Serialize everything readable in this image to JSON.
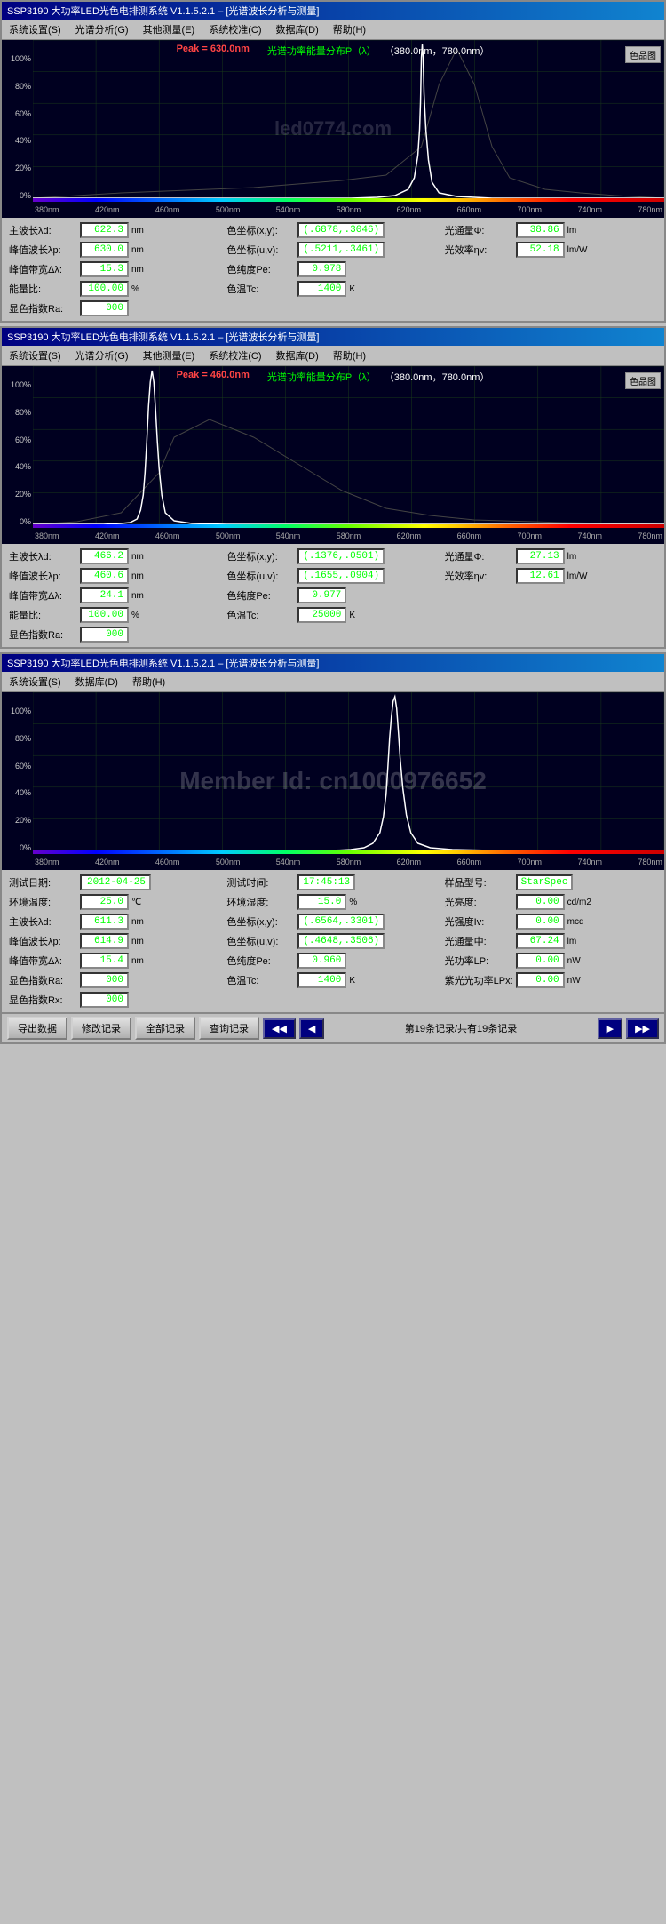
{
  "panels": [
    {
      "id": "panel1",
      "title": "SSP3190  大功率LED光色电排测系统 V1.1.5.2.1 – [光谱波长分析与测量]",
      "menu": [
        "系统设置(S)",
        "光谱分析(G)",
        "其他测量(E)",
        "系统校准(C)",
        "数据库(D)",
        "帮助(H)"
      ],
      "chart": {
        "peak_label": "Peak = 630.0nm",
        "range_label": "光谱功率能量分布P（λ）",
        "range_value": "（380.0nm，780.0nm）",
        "color_btn": "色品图",
        "watermark": "led0774.com",
        "y_axis": [
          "100%",
          "80%",
          "60%",
          "40%",
          "20%",
          "0%"
        ],
        "x_axis": [
          "380nm",
          "420nm",
          "460nm",
          "500nm",
          "540nm",
          "580nm",
          "620nm",
          "660nm",
          "700nm",
          "740nm",
          "780nm"
        ],
        "curve_peak_x": 0.615,
        "curve_type": "red_narrow"
      },
      "data": [
        {
          "label": "主波长λd:",
          "value": "622.3",
          "unit": "nm",
          "col": 1
        },
        {
          "label": "色坐标(x,y):",
          "value": "(.6878,.3046)",
          "unit": "",
          "col": 2
        },
        {
          "label": "光通量Φ:",
          "value": "38.86",
          "unit": "lm",
          "col": 3
        },
        {
          "label": "峰值波长λp:",
          "value": "630.0",
          "unit": "nm",
          "col": 1
        },
        {
          "label": "色坐标(u,v):",
          "value": "(.5211,.3461)",
          "unit": "",
          "col": 2
        },
        {
          "label": "光效率ηv:",
          "value": "52.18",
          "unit": "lm/W",
          "col": 3
        },
        {
          "label": "峰值带宽Δλ:",
          "value": "15.3",
          "unit": "nm",
          "col": 1
        },
        {
          "label": "色纯度Pe:",
          "value": "0.978",
          "unit": "",
          "col": 2
        },
        {
          "label": "",
          "value": "",
          "unit": "",
          "col": 3
        },
        {
          "label": "能量比:",
          "value": "100.00",
          "unit": "%",
          "col": 1
        },
        {
          "label": "色温Tc:",
          "value": "1400",
          "unit": "K",
          "col": 2
        },
        {
          "label": "",
          "value": "",
          "unit": "",
          "col": 3
        },
        {
          "label": "显色指数Ra:",
          "value": "000",
          "unit": "",
          "col": 1
        },
        {
          "label": "",
          "value": "",
          "unit": "",
          "col": 2
        },
        {
          "label": "",
          "value": "",
          "unit": "",
          "col": 3
        }
      ]
    },
    {
      "id": "panel2",
      "title": "SSP3190  大功率LED光色电排测系统 V1.1.5.2.1 – [光谱波长分析与测量]",
      "menu": [
        "系统设置(S)",
        "光谱分析(G)",
        "其他测量(E)",
        "系统校准(C)",
        "数据库(D)",
        "帮助(H)"
      ],
      "chart": {
        "peak_label": "Peak = 460.0nm",
        "range_label": "光谱功率能量分布P（λ）",
        "range_value": "（380.0nm，780.0nm）",
        "color_btn": "色品图",
        "watermark": "",
        "y_axis": [
          "100%",
          "80%",
          "60%",
          "40%",
          "20%",
          "0%"
        ],
        "x_axis": [
          "380nm",
          "420nm",
          "460nm",
          "500nm",
          "540nm",
          "580nm",
          "620nm",
          "660nm",
          "700nm",
          "740nm",
          "780nm"
        ],
        "curve_peak_x": 0.21,
        "curve_type": "blue_narrow"
      },
      "data": [
        {
          "label": "主波长λd:",
          "value": "466.2",
          "unit": "nm",
          "col": 1
        },
        {
          "label": "色坐标(x,y):",
          "value": "(.1376,.0501)",
          "unit": "",
          "col": 2
        },
        {
          "label": "光通量Φ:",
          "value": "27.13",
          "unit": "lm",
          "col": 3
        },
        {
          "label": "峰值波长λp:",
          "value": "460.6",
          "unit": "nm",
          "col": 1
        },
        {
          "label": "色坐标(u,v):",
          "value": "(.1655,.0904)",
          "unit": "",
          "col": 2
        },
        {
          "label": "光效率ηv:",
          "value": "12.61",
          "unit": "lm/W",
          "col": 3
        },
        {
          "label": "峰值带宽Δλ:",
          "value": "24.1",
          "unit": "nm",
          "col": 1
        },
        {
          "label": "色纯度Pe:",
          "value": "0.977",
          "unit": "",
          "col": 2
        },
        {
          "label": "",
          "value": "",
          "unit": "",
          "col": 3
        },
        {
          "label": "能量比:",
          "value": "100.00",
          "unit": "%",
          "col": 1
        },
        {
          "label": "色温Tc:",
          "value": "25000",
          "unit": "K",
          "col": 2
        },
        {
          "label": "",
          "value": "",
          "unit": "",
          "col": 3
        },
        {
          "label": "显色指数Ra:",
          "value": "000",
          "unit": "",
          "col": 1
        },
        {
          "label": "",
          "value": "",
          "unit": "",
          "col": 3
        }
      ]
    }
  ],
  "panel3": {
    "title": "SSP3190  大功率LED光色电排测系统 V1.1.5.2.1 – [光谱波长分析与测量]",
    "menu": [
      "系统设置(S)",
      "数据库(D)",
      "帮助(H)"
    ],
    "watermark": "Member Id: cn1000976652",
    "chart": {
      "peak_label": "",
      "y_axis": [
        "100%",
        "80%",
        "60%",
        "40%",
        "20%",
        "0%"
      ],
      "x_axis": [
        "380nm",
        "420nm",
        "460nm",
        "500nm",
        "540nm",
        "580nm",
        "620nm",
        "660nm",
        "700nm",
        "740nm",
        "780nm"
      ],
      "curve_peak_x": 0.59,
      "curve_type": "warm_narrow"
    },
    "data_rows": [
      [
        {
          "label": "测试日期:",
          "value": "2012-04-25",
          "unit": ""
        },
        {
          "label": "测试时间:",
          "value": "17:45:13",
          "unit": ""
        },
        {
          "label": "样品型号:",
          "value": "StarSpec",
          "unit": ""
        }
      ],
      [
        {
          "label": "环境温度:",
          "value": "25.0",
          "unit": "℃"
        },
        {
          "label": "环境湿度:",
          "value": "15.0",
          "unit": "%"
        },
        {
          "label": "光亮度:",
          "value": "0.00",
          "unit": "cd/m2"
        }
      ],
      [
        {
          "label": "主波长λd:",
          "value": "611.3",
          "unit": "nm"
        },
        {
          "label": "色坐标(x,y):",
          "value": "(.6564,.3301)",
          "unit": ""
        },
        {
          "label": "光强度Iv:",
          "value": "0.00",
          "unit": "mcd"
        }
      ],
      [
        {
          "label": "峰值波长λp:",
          "value": "614.9",
          "unit": "nm"
        },
        {
          "label": "色坐标(u,v):",
          "value": "(.4648,.3506)",
          "unit": ""
        },
        {
          "label": "光通量中:",
          "value": "67.24",
          "unit": "lm"
        }
      ],
      [
        {
          "label": "峰值带宽Δλ:",
          "value": "15.4",
          "unit": "nm"
        },
        {
          "label": "色纯度Pe:",
          "value": "0.960",
          "unit": ""
        },
        {
          "label": "光功率LP:",
          "value": "0.00",
          "unit": "nW"
        }
      ],
      [
        {
          "label": "显色指数Ra:",
          "value": "000",
          "unit": ""
        },
        {
          "label": "色温Tc:",
          "value": "1400",
          "unit": "K"
        },
        {
          "label": "紫光光功率LPx:",
          "value": "0.00",
          "unit": "nW"
        }
      ],
      [
        {
          "label": "显色指数Rx:",
          "value": "000",
          "unit": ""
        },
        {
          "label": "",
          "value": "",
          "unit": ""
        },
        {
          "label": "",
          "value": "",
          "unit": ""
        }
      ]
    ],
    "toolbar": {
      "btn_export": "导出数据",
      "btn_modify": "修改记录",
      "btn_all": "全部记录",
      "btn_query": "查询记录",
      "record_info": "第19条记录/共有19条记录"
    }
  }
}
